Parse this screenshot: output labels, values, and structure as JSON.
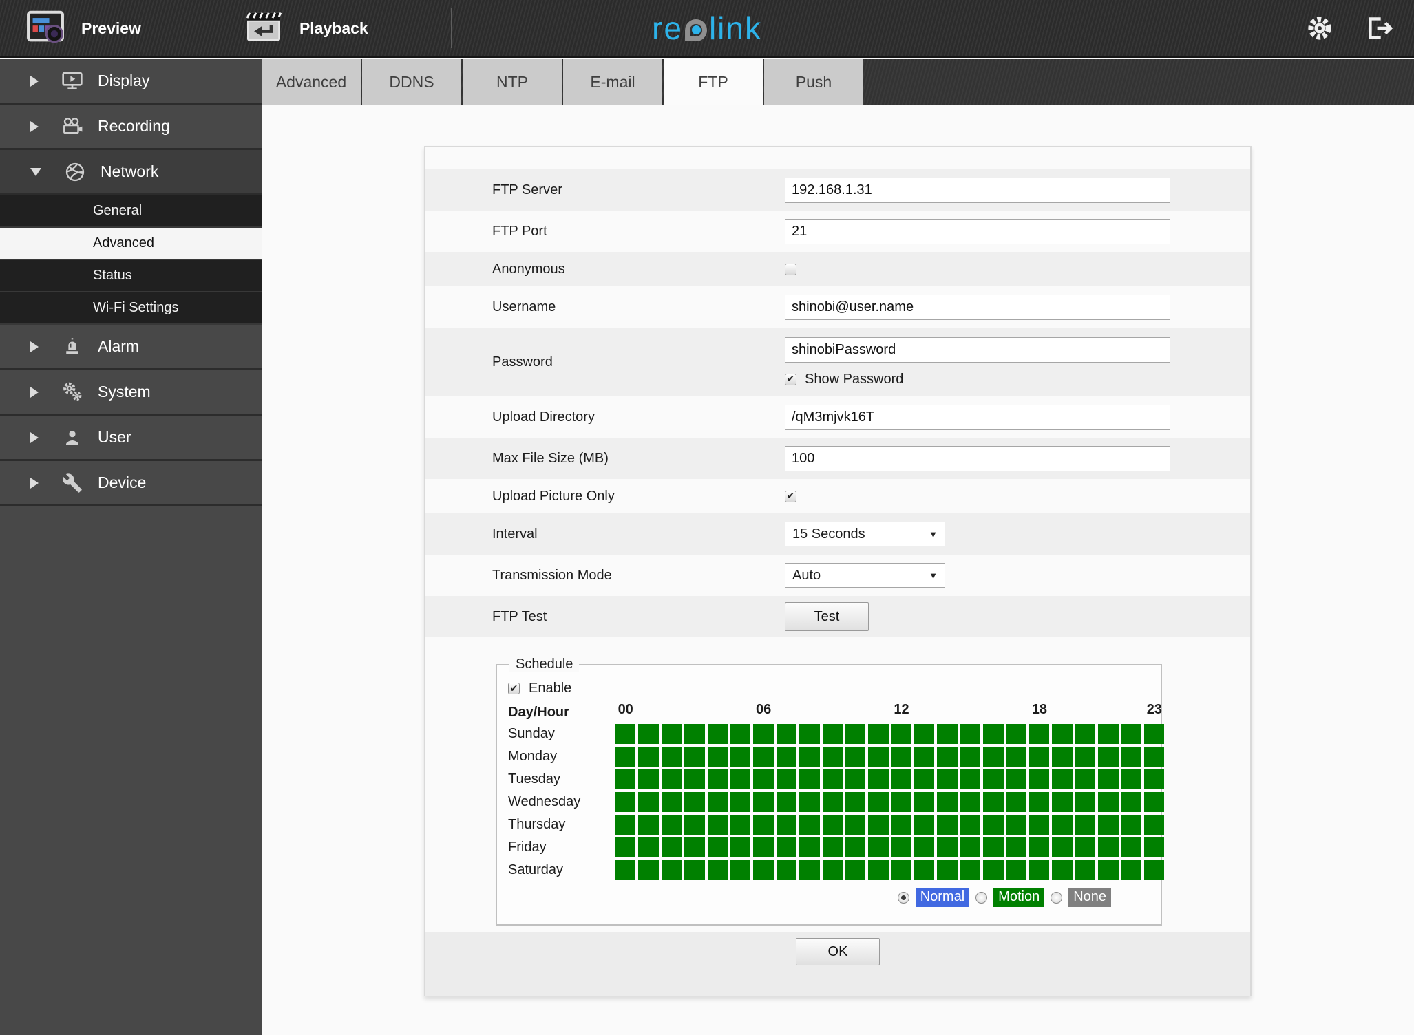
{
  "topbar": {
    "preview_label": "Preview",
    "playback_label": "Playback",
    "logo": {
      "part1": "re",
      "part2": "link",
      "brand_color": "#2db3ea"
    }
  },
  "tabs": [
    {
      "label": "Advanced",
      "active": false
    },
    {
      "label": "DDNS",
      "active": false
    },
    {
      "label": "NTP",
      "active": false
    },
    {
      "label": "E-mail",
      "active": false
    },
    {
      "label": "FTP",
      "active": true
    },
    {
      "label": "Push",
      "active": false
    }
  ],
  "sidebar": {
    "items": [
      {
        "label": "Display",
        "icon": "display-monitor-icon",
        "expanded": false
      },
      {
        "label": "Recording",
        "icon": "recording-camera-icon",
        "expanded": false
      },
      {
        "label": "Network",
        "icon": "network-globe-icon",
        "expanded": true,
        "children": [
          {
            "label": "General",
            "selected": false
          },
          {
            "label": "Advanced",
            "selected": true
          },
          {
            "label": "Status",
            "selected": false
          },
          {
            "label": "Wi-Fi Settings",
            "selected": false
          }
        ]
      },
      {
        "label": "Alarm",
        "icon": "alarm-siren-icon",
        "expanded": false
      },
      {
        "label": "System",
        "icon": "system-gears-icon",
        "expanded": false
      },
      {
        "label": "User",
        "icon": "user-icon",
        "expanded": false
      },
      {
        "label": "Device",
        "icon": "device-wrench-icon",
        "expanded": false
      }
    ]
  },
  "form": {
    "ftp_server": {
      "label": "FTP Server",
      "value": "192.168.1.31"
    },
    "ftp_port": {
      "label": "FTP Port",
      "value": "21"
    },
    "anonymous": {
      "label": "Anonymous",
      "checked": false
    },
    "username": {
      "label": "Username",
      "value": "shinobi@user.name"
    },
    "password": {
      "label": "Password",
      "value": "shinobiPassword",
      "show_password_label": "Show Password",
      "show_password_checked": true
    },
    "upload_directory": {
      "label": "Upload Directory",
      "value": "/qM3mjvk16T"
    },
    "max_file_size": {
      "label": "Max File Size (MB)",
      "value": "100"
    },
    "upload_picture_only": {
      "label": "Upload Picture Only",
      "checked": true
    },
    "interval": {
      "label": "Interval",
      "value": "15 Seconds"
    },
    "transmission_mode": {
      "label": "Transmission Mode",
      "value": "Auto"
    },
    "ftp_test": {
      "label": "FTP Test",
      "button_label": "Test"
    },
    "ok_label": "OK"
  },
  "schedule": {
    "legend": "Schedule",
    "enable_label": "Enable",
    "enable_checked": true,
    "day_hour_label": "Day/Hour",
    "hour_labels": [
      {
        "text": "00",
        "col": 0
      },
      {
        "text": "06",
        "col": 6
      },
      {
        "text": "12",
        "col": 12
      },
      {
        "text": "18",
        "col": 18
      },
      {
        "text": "23",
        "col": 23
      }
    ],
    "days": [
      "Sunday",
      "Monday",
      "Tuesday",
      "Wednesday",
      "Thursday",
      "Friday",
      "Saturday"
    ],
    "columns": 24,
    "grid_fill": "motion",
    "legend_options": [
      {
        "label": "Normal",
        "value": "normal",
        "color": "#4169e1",
        "selected": true
      },
      {
        "label": "Motion",
        "value": "motion",
        "color": "#008000",
        "selected": false
      },
      {
        "label": "None",
        "value": "none",
        "color": "#808080",
        "selected": false
      }
    ]
  }
}
